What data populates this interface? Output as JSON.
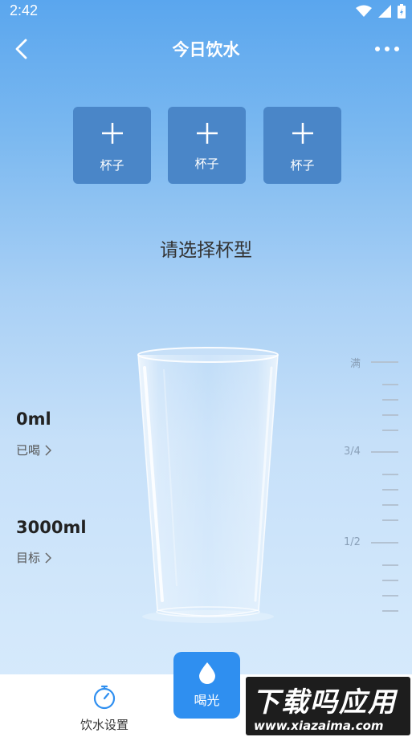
{
  "status_bar": {
    "time": "2:42"
  },
  "header": {
    "title": "今日饮水"
  },
  "cups": [
    {
      "label": "杯子"
    },
    {
      "label": "杯子"
    },
    {
      "label": "杯子"
    }
  ],
  "hint": "请选择杯型",
  "stats": {
    "drunk_value": "0ml",
    "drunk_label": "已喝",
    "target_value": "3000ml",
    "target_label": "目标"
  },
  "scale": {
    "full": "满",
    "three_quarter": "3/4",
    "half": "1/2"
  },
  "fill_level": 0,
  "bottom_nav": {
    "settings_label": "饮水设置",
    "drink_label": "喝光"
  },
  "watermark": {
    "main": "下载吗应用",
    "url": "www.xiazaima.com"
  },
  "colors": {
    "accent": "#2f8ff0",
    "card": "#4a86c8"
  }
}
